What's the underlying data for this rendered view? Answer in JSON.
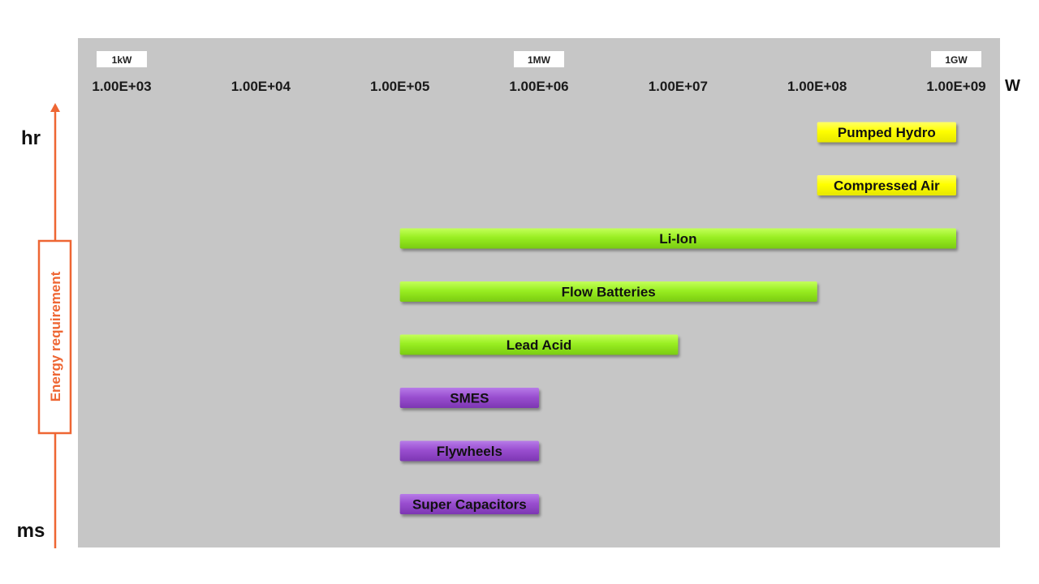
{
  "chart_data": {
    "type": "bar",
    "orientation": "horizontal-range",
    "title": "",
    "xlabel": "W",
    "x_scale": "log",
    "xlim": [
      1000,
      1000000000
    ],
    "x_ticks": [
      {
        "value": 1000,
        "label": "1.00E+03"
      },
      {
        "value": 10000,
        "label": "1.00E+04"
      },
      {
        "value": 100000,
        "label": "1.00E+05"
      },
      {
        "value": 1000000,
        "label": "1.00E+06"
      },
      {
        "value": 10000000,
        "label": "1.00E+07"
      },
      {
        "value": 100000000,
        "label": "1.00E+08"
      },
      {
        "value": 1000000000,
        "label": "1.00E+09"
      }
    ],
    "unit_labels": [
      {
        "value": 1000,
        "label": "1kW"
      },
      {
        "value": 1000000,
        "label": "1MW"
      },
      {
        "value": 1000000000,
        "label": "1GW"
      }
    ],
    "ylabel": "Energy requirement",
    "y_top_label": "hr",
    "y_bottom_label": "ms",
    "grid": false,
    "colors": {
      "panel": "#c6c6c6",
      "yellow": "#ffff00",
      "green": "#99ee22",
      "purple": "#9a4fd0",
      "axis_arrow": "#ee6633"
    },
    "series": [
      {
        "name": "Pumped Hydro",
        "min": 100000000,
        "max": 1000000000,
        "color": "yellow"
      },
      {
        "name": "Compressed Air",
        "min": 100000000,
        "max": 1000000000,
        "color": "yellow"
      },
      {
        "name": "Li-Ion",
        "min": 100000,
        "max": 1000000000,
        "color": "green"
      },
      {
        "name": "Flow Batteries",
        "min": 100000,
        "max": 100000000,
        "color": "green"
      },
      {
        "name": "Lead Acid",
        "min": 100000,
        "max": 10000000,
        "color": "green"
      },
      {
        "name": "SMES",
        "min": 100000,
        "max": 1000000,
        "color": "purple"
      },
      {
        "name": "Flywheels",
        "min": 100000,
        "max": 1000000,
        "color": "purple"
      },
      {
        "name": "Super Capacitors",
        "min": 100000,
        "max": 1000000,
        "color": "purple"
      }
    ]
  }
}
